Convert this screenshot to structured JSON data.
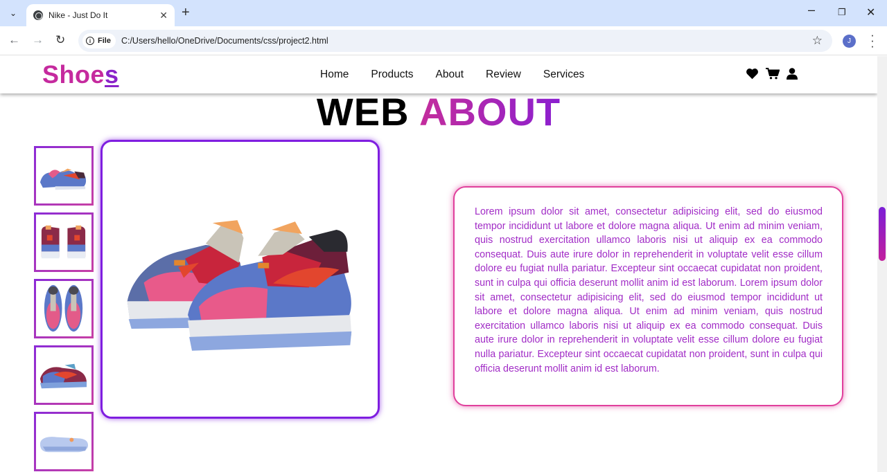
{
  "browser": {
    "tab_title": "Nike - Just Do It",
    "chip_label": "File",
    "url": "C:/Users/hello/OneDrive/Documents/css/project2.html",
    "avatar_initial": "J"
  },
  "site": {
    "logo_main": "Shoe",
    "logo_last": "s",
    "nav": [
      "Home",
      "Products",
      "About",
      "Review",
      "Services"
    ],
    "header_icons": [
      "heart-icon",
      "cart-icon",
      "user-icon"
    ],
    "heading_word1": "WEB",
    "heading_word2": "ABOUT",
    "thumbnails": [
      "shoe-pair-side-thumbnail",
      "shoe-pair-back-thumbnail",
      "shoe-pair-top-thumbnail",
      "shoe-single-side-thumbnail",
      "shoe-sole-thumbnail"
    ],
    "about_text": "Lorem ipsum dolor sit amet, consectetur adipisicing elit, sed do eiusmod tempor incididunt ut labore et dolore magna aliqua. Ut enim ad minim veniam, quis nostrud exercitation ullamco laboris nisi ut aliquip ex ea commodo consequat. Duis aute irure dolor in reprehenderit in voluptate velit esse cillum dolore eu fugiat nulla pariatur. Excepteur sint occaecat cupidatat non proident, sunt in culpa qui officia deserunt mollit anim id est laborum. Lorem ipsum dolor sit amet, consectetur adipisicing elit, sed do eiusmod tempor incididunt ut labore et dolore magna aliqua. Ut enim ad minim veniam, quis nostrud exercitation ullamco laboris nisi ut aliquip ex ea commodo consequat. Duis aute irure dolor in reprehenderit in voluptate velit esse cillum dolore eu fugiat nulla pariatur. Excepteur sint occaecat cupidatat non proident, sunt in culpa qui officia deserunt mollit anim id est laborum."
  },
  "colors": {
    "accent_pink": "#c52a9e",
    "accent_purple": "#8a23c9",
    "text_purple": "#a12cc6"
  }
}
